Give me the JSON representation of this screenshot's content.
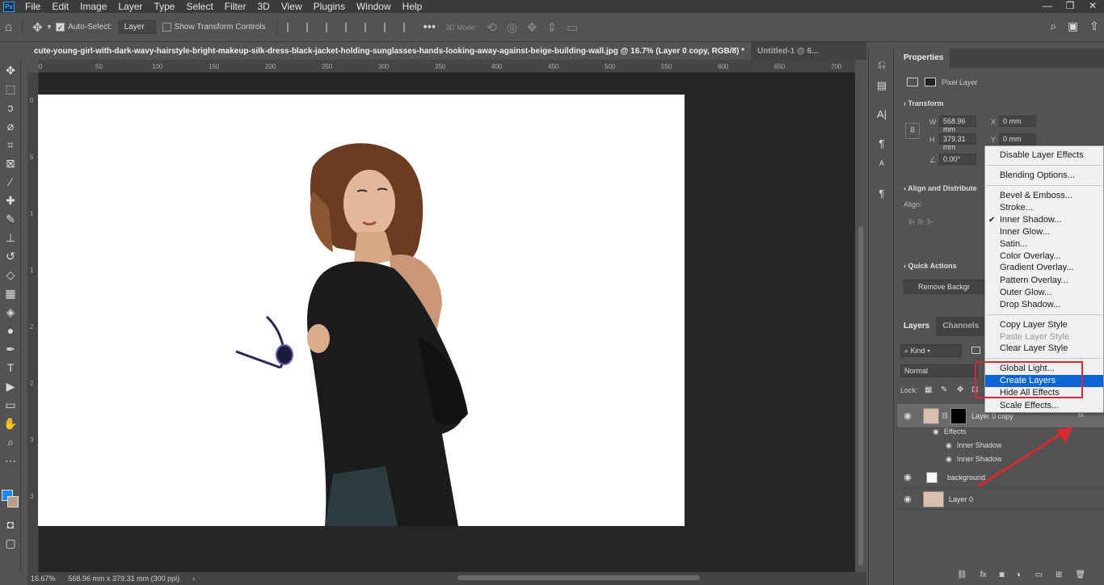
{
  "menubar": {
    "logo": "Ps",
    "items": [
      "File",
      "Edit",
      "Image",
      "Layer",
      "Type",
      "Select",
      "Filter",
      "3D",
      "View",
      "Plugins",
      "Window",
      "Help"
    ],
    "window_controls": [
      "—",
      "❐",
      "✕"
    ]
  },
  "options_bar": {
    "auto_select_label": "Auto-Select:",
    "auto_select_value": "Layer",
    "show_transform_label": "Show Transform Controls",
    "mode_3d_label": "3D Mode:",
    "more_label": "•••"
  },
  "tabs": [
    {
      "label": "cute-young-girl-with-dark-wavy-hairstyle-bright-makeup-silk-dress-black-jacket-holding-sunglasses-hands-looking-away-against-beige-building-wall.jpg @ 16.7% (Layer 0 copy, RGB/8) *"
    },
    {
      "label": "Untitled-1 @ 6..."
    }
  ],
  "ruler_h_labels": [
    "0",
    "50",
    "100",
    "150",
    "200",
    "250",
    "300",
    "350",
    "400",
    "450",
    "500",
    "550",
    "600",
    "650",
    "700"
  ],
  "ruler_v_labels": [
    "0",
    "5",
    "1",
    "1",
    "2",
    "2",
    "3",
    "3"
  ],
  "status": {
    "zoom": "16.67%",
    "doc_size": "568.96 mm x 379.31 mm (300 ppi)",
    "arrow": "›"
  },
  "properties": {
    "tab": "Properties",
    "layer_type": "Pixel Layer",
    "transform_title": "Transform",
    "w_label": "W",
    "w_value": "568.96 mm",
    "h_label": "H",
    "h_value": "379.31 mm",
    "x_label": "X",
    "x_value": "0 mm",
    "y_label": "Y",
    "y_value": "0 mm",
    "angle_value": "0.00°",
    "align_title": "Align and Distribute",
    "align_label": "Align:",
    "quick_actions_title": "Quick Actions",
    "remove_bg_label": "Remove Backgr"
  },
  "layers": {
    "tabs": [
      "Layers",
      "Channels",
      "P"
    ],
    "kind_label": "Kind",
    "blend_mode": "Normal",
    "lock_label": "Lock:",
    "rows": [
      {
        "name": "Layer 0 copy",
        "fx": "fx"
      },
      {
        "name": "background"
      },
      {
        "name": "Layer 0"
      }
    ],
    "effects_label": "Effects",
    "effect_items": [
      "Inner Shadow",
      "Inner Shadow"
    ]
  },
  "context_menu": {
    "items": [
      {
        "label": "Disable Layer Effects"
      },
      {
        "label": "Blending Options..."
      },
      {
        "label": "Bevel & Emboss..."
      },
      {
        "label": "Stroke..."
      },
      {
        "label": "Inner Shadow...",
        "checked": "✔"
      },
      {
        "label": "Inner Glow..."
      },
      {
        "label": "Satin..."
      },
      {
        "label": "Color Overlay..."
      },
      {
        "label": "Gradient Overlay..."
      },
      {
        "label": "Pattern Overlay..."
      },
      {
        "label": "Outer Glow..."
      },
      {
        "label": "Drop Shadow..."
      },
      {
        "label": "Copy Layer Style"
      },
      {
        "label": "Paste Layer Style"
      },
      {
        "label": "Clear Layer Style"
      },
      {
        "label": "Global Light..."
      },
      {
        "label": "Create Layers"
      },
      {
        "label": "Hide All Effects"
      },
      {
        "label": "Scale Effects..."
      }
    ]
  },
  "colors": {
    "highlight": "#0a66d6",
    "annotation_red": "#d9282f",
    "foreground_swatch": "#1a8cff",
    "background_swatch": "#b99d88"
  }
}
